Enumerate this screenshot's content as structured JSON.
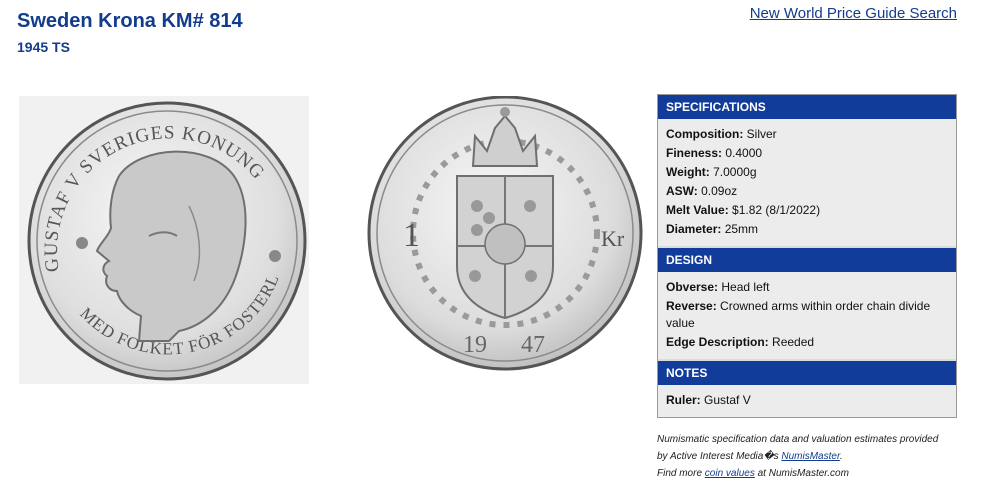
{
  "header": {
    "title": "Sweden Krona KM# 814",
    "subtitle": "1945 TS",
    "search_link": "New World Price Guide Search"
  },
  "coin": {
    "obverse_legend_top": "GUSTAF V SVERIGES KONUNG",
    "obverse_legend_bottom": "MED FOLKET FÖR FOSTERLANDET",
    "reverse_value": "1",
    "reverse_unit": "Kr",
    "reverse_year_left": "19",
    "reverse_year_right": "47",
    "metal_color": "#8a8a8a"
  },
  "specifications": {
    "heading": "SPECIFICATIONS",
    "rows": [
      {
        "label": "Composition:",
        "value": "Silver"
      },
      {
        "label": "Fineness:",
        "value": "0.4000"
      },
      {
        "label": "Weight:",
        "value": "7.0000g"
      },
      {
        "label": "ASW:",
        "value": "0.09oz"
      },
      {
        "label": "Melt Value:",
        "value": "$1.82 (8/1/2022)"
      },
      {
        "label": "Diameter:",
        "value": "25mm"
      }
    ]
  },
  "design": {
    "heading": "DESIGN",
    "rows": [
      {
        "label": "Obverse:",
        "value": "Head left"
      },
      {
        "label": "Reverse:",
        "value": "Crowned arms within order chain divide value"
      },
      {
        "label": "Edge Description:",
        "value": "Reeded"
      }
    ]
  },
  "notes": {
    "heading": "NOTES",
    "rows": [
      {
        "label": "Ruler:",
        "value": "Gustaf V"
      }
    ]
  },
  "footnote": {
    "line1": "Numismatic specification data and valuation estimates provided",
    "line2_pre": "by Active Interest Media�s ",
    "line2_link": "NumisMaster",
    "line2_post": ".",
    "line3_pre": "Find more ",
    "line3_link": "coin values",
    "line3_post": " at NumisMaster.com"
  },
  "colors": {
    "header_text": "#123c8c",
    "section_header_bg": "#123c9a",
    "panel_bg": "#ececec"
  }
}
